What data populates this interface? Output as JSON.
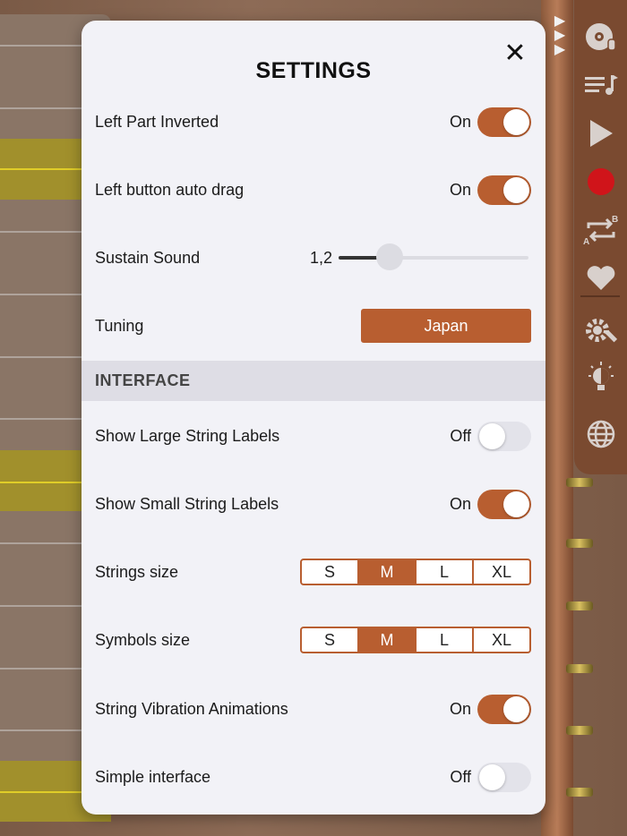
{
  "dialog": {
    "title": "SETTINGS",
    "close_icon": "✕"
  },
  "rows": {
    "left_part_inverted": {
      "label": "Left Part Inverted",
      "state": "On",
      "on": true
    },
    "left_button_auto_drag": {
      "label": "Left button auto drag",
      "state": "On",
      "on": true
    },
    "sustain_sound": {
      "label": "Sustain Sound",
      "value": "1,2",
      "level": 0.27
    },
    "tuning": {
      "label": "Tuning",
      "value": "Japan"
    }
  },
  "interface_section": {
    "title": "INTERFACE",
    "show_large_string_labels": {
      "label": "Show Large String Labels",
      "state": "Off",
      "on": false
    },
    "show_small_string_labels": {
      "label": "Show Small String Labels",
      "state": "On",
      "on": true
    },
    "strings_size": {
      "label": "Strings size",
      "options": [
        "S",
        "M",
        "L",
        "XL"
      ],
      "selected": "M"
    },
    "symbols_size": {
      "label": "Symbols size",
      "options": [
        "S",
        "M",
        "L",
        "XL"
      ],
      "selected": "M"
    },
    "string_vibration_animations": {
      "label": "String Vibration Animations",
      "state": "On",
      "on": true
    },
    "simple_interface": {
      "label": "Simple interface",
      "state": "Off",
      "on": false
    }
  },
  "toolbar": {
    "icons": [
      "vinyl-record-icon",
      "playlist-icon",
      "play-icon",
      "record-icon",
      "repeat-ab-icon",
      "heart-icon",
      "settings-icon",
      "lightbulb-icon",
      "globe-icon"
    ]
  },
  "colors": {
    "accent": "#b85e30",
    "dialog_bg": "#f2f2f7",
    "section_bg": "#dedde5",
    "record_red": "#d0141a"
  }
}
